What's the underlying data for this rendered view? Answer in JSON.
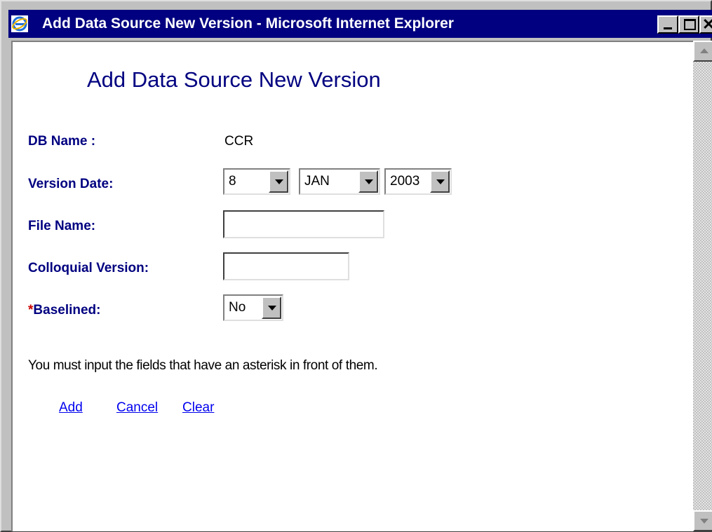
{
  "window": {
    "title": "Add Data Source New Version - Microsoft Internet Explorer",
    "icon": "ie-icon",
    "close_glyph": "✕"
  },
  "page": {
    "heading": "Add Data Source New Version",
    "db_name": {
      "label": "DB Name :",
      "value": "CCR"
    },
    "version_date": {
      "label": "Version Date:",
      "day": "8",
      "month": "JAN",
      "year": "2003"
    },
    "file_name": {
      "label": "File Name:",
      "value": ""
    },
    "colloquial_version": {
      "label": "Colloquial Version:",
      "value": ""
    },
    "baselined": {
      "required_mark": "*",
      "label": "Baselined:",
      "value": "No"
    },
    "note": "You must input the fields that have an asterisk in front of them.",
    "links": {
      "add": "Add",
      "cancel": "Cancel",
      "clear": "Clear"
    }
  },
  "colors": {
    "titlebar": "#000080",
    "label": "#000080",
    "required": "#cc0000",
    "link": "#0000ee"
  }
}
